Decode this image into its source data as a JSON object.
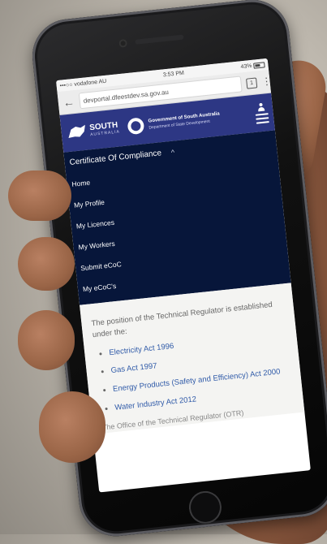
{
  "status_bar": {
    "carrier": "•••○○ vodafone AU",
    "time": "3:53 PM",
    "battery": "43%"
  },
  "address_bar": {
    "url": "devportal.dfeestdev.sa.gov.au",
    "tab_count": "1"
  },
  "header": {
    "logo_text": "SOUTH",
    "logo_subtext": "AUSTRALIA",
    "gov_name": "Government of South Australia",
    "dept_name": "Department of State Development"
  },
  "nav": {
    "section_title": "Certificate Of Compliance",
    "items": [
      {
        "label": "Home"
      },
      {
        "label": "My Profile"
      },
      {
        "label": "My Licences"
      },
      {
        "label": "My Workers"
      },
      {
        "label": "Submit eCoC"
      },
      {
        "label": "My eCoC's"
      }
    ]
  },
  "content": {
    "intro": "The position of the Technical Regulator is established under the:",
    "acts": [
      "Electricity Act 1996",
      "Gas Act 1997",
      "Energy Products (Safety and Efficiency) Act 2000",
      "Water Industry Act 2012"
    ],
    "trailing": "The Office of the Technical Regulator (OTR)"
  },
  "colors": {
    "header_bg": "#2d3784",
    "nav_bg": "#07163a",
    "link": "#2f5aa8"
  },
  "icons": {
    "back": "back-arrow-icon",
    "tabs": "tab-count-icon",
    "menu": "kebab-menu-icon",
    "user": "user-icon",
    "hamburger": "hamburger-icon",
    "chevron": "chevron-up-icon"
  }
}
